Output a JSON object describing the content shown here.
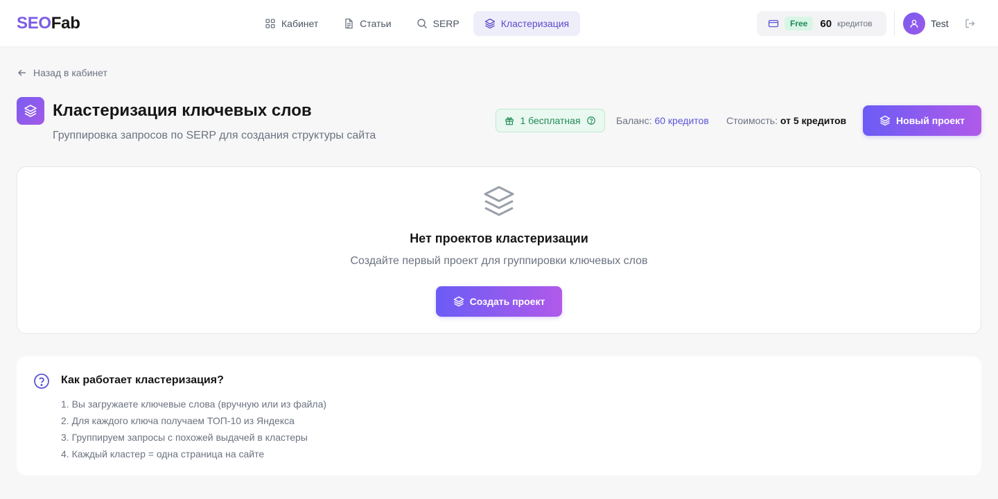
{
  "header": {
    "logo_part1": "SEO",
    "logo_part2": "Fab",
    "nav": [
      {
        "label": "Кабинет",
        "icon": "grid-icon"
      },
      {
        "label": "Статьи",
        "icon": "document-icon"
      },
      {
        "label": "SERP",
        "icon": "search-icon"
      },
      {
        "label": "Кластеризация",
        "icon": "layers-icon",
        "active": true
      }
    ],
    "plan_badge": "Free",
    "credits_value": "60",
    "credits_label": "кредитов",
    "user_name": "Test"
  },
  "back_link": "Назад в кабинет",
  "page": {
    "title": "Кластеризация ключевых слов",
    "subtitle": "Группировка запросов по SERP для создания структуры сайта",
    "free_badge": "1 бесплатная",
    "balance_label": "Баланс:",
    "balance_value": "60 кредитов",
    "cost_label": "Стоимость:",
    "cost_value": "от 5 кредитов",
    "new_project_button": "Новый проект"
  },
  "empty_state": {
    "title": "Нет проектов кластеризации",
    "subtitle": "Создайте первый проект для группировки ключевых слов",
    "button": "Создать проект"
  },
  "info": {
    "title": "Как работает кластеризация?",
    "steps": [
      "1. Вы загружаете ключевые слова (вручную или из файла)",
      "2. Для каждого ключа получаем ТОП-10 из Яндекса",
      "3. Группируем запросы с похожей выдачей в кластеры",
      "4. Каждый кластер = одна страница на сайте"
    ]
  },
  "colors": {
    "accent": "#6b5cf5",
    "accent_end": "#b05ae9",
    "success": "#1f8a55",
    "link": "#5b55d6"
  }
}
